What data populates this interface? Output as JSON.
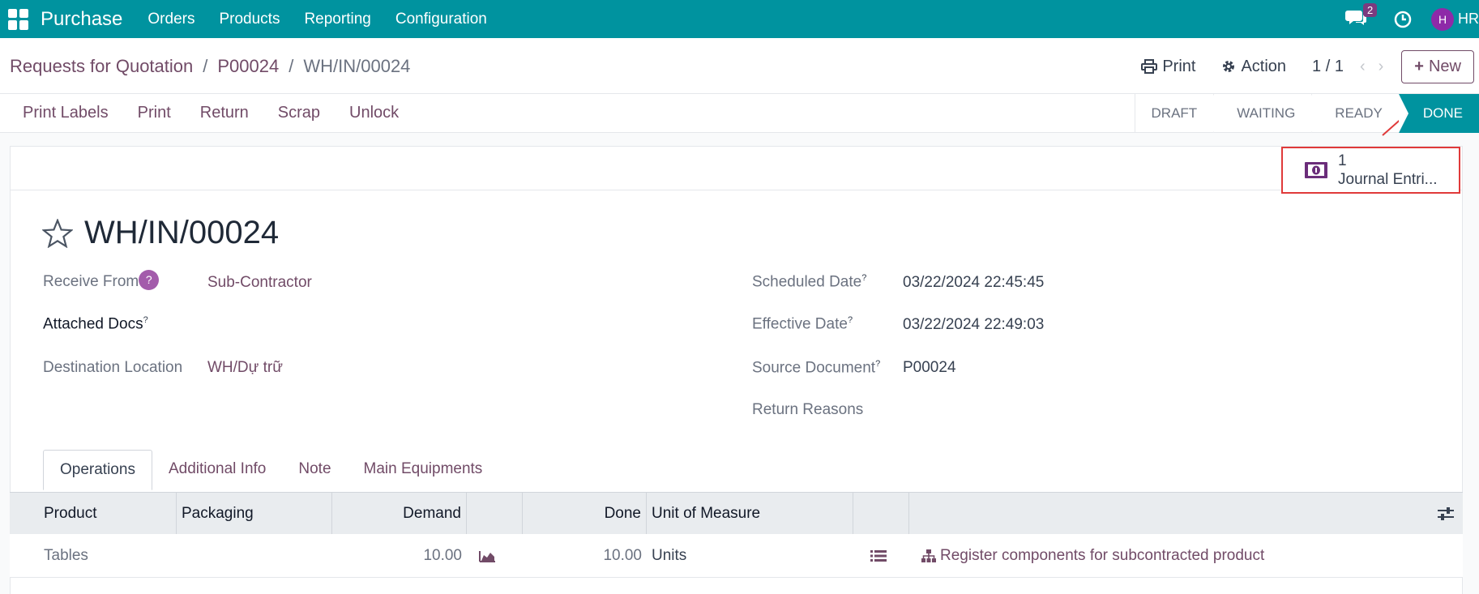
{
  "navbar": {
    "app_name": "Purchase",
    "menu": [
      "Orders",
      "Products",
      "Reporting",
      "Configuration"
    ],
    "message_count": "2",
    "user_initial": "H",
    "user_name": "HR"
  },
  "breadcrumb": {
    "items": [
      "Requests for Quotation",
      "P00024"
    ],
    "separator": "/",
    "current": "WH/IN/00024"
  },
  "control": {
    "print_label": "Print",
    "action_label": "Action",
    "pager": "1 / 1",
    "new_label": "New"
  },
  "actions": {
    "buttons": [
      "Print Labels",
      "Print",
      "Return",
      "Scrap",
      "Unlock"
    ]
  },
  "status": {
    "stages": [
      "DRAFT",
      "WAITING",
      "READY",
      "DONE"
    ],
    "current": "DONE"
  },
  "smart_button": {
    "count": "1",
    "label": "Journal Entri..."
  },
  "record": {
    "title": "WH/IN/00024",
    "receive_from_label": "Receive From",
    "receive_from_value": "Sub-Contractor",
    "attached_docs_label": "Attached Docs",
    "destination_label": "Destination Location",
    "destination_value": "WH/Dự trữ",
    "scheduled_label": "Scheduled Date",
    "scheduled_value": "03/22/2024 22:45:45",
    "effective_label": "Effective Date",
    "effective_value": "03/22/2024 22:49:03",
    "source_label": "Source Document",
    "source_value": "P00024",
    "return_reasons_label": "Return Reasons",
    "help_mark": "?"
  },
  "tabs": [
    "Operations",
    "Additional Info",
    "Note",
    "Main Equipments"
  ],
  "table": {
    "columns": {
      "product": "Product",
      "packaging": "Packaging",
      "demand": "Demand",
      "done": "Done",
      "uom": "Unit of Measure"
    },
    "rows": [
      {
        "product": "Tables",
        "packaging": "",
        "demand": "10.00",
        "done": "10.00",
        "uom": "Units",
        "action": "Register components for subcontracted product"
      }
    ]
  },
  "colors": {
    "navbar": "#00939f",
    "primary": "#714b67",
    "highlight": "#e03a3a"
  }
}
